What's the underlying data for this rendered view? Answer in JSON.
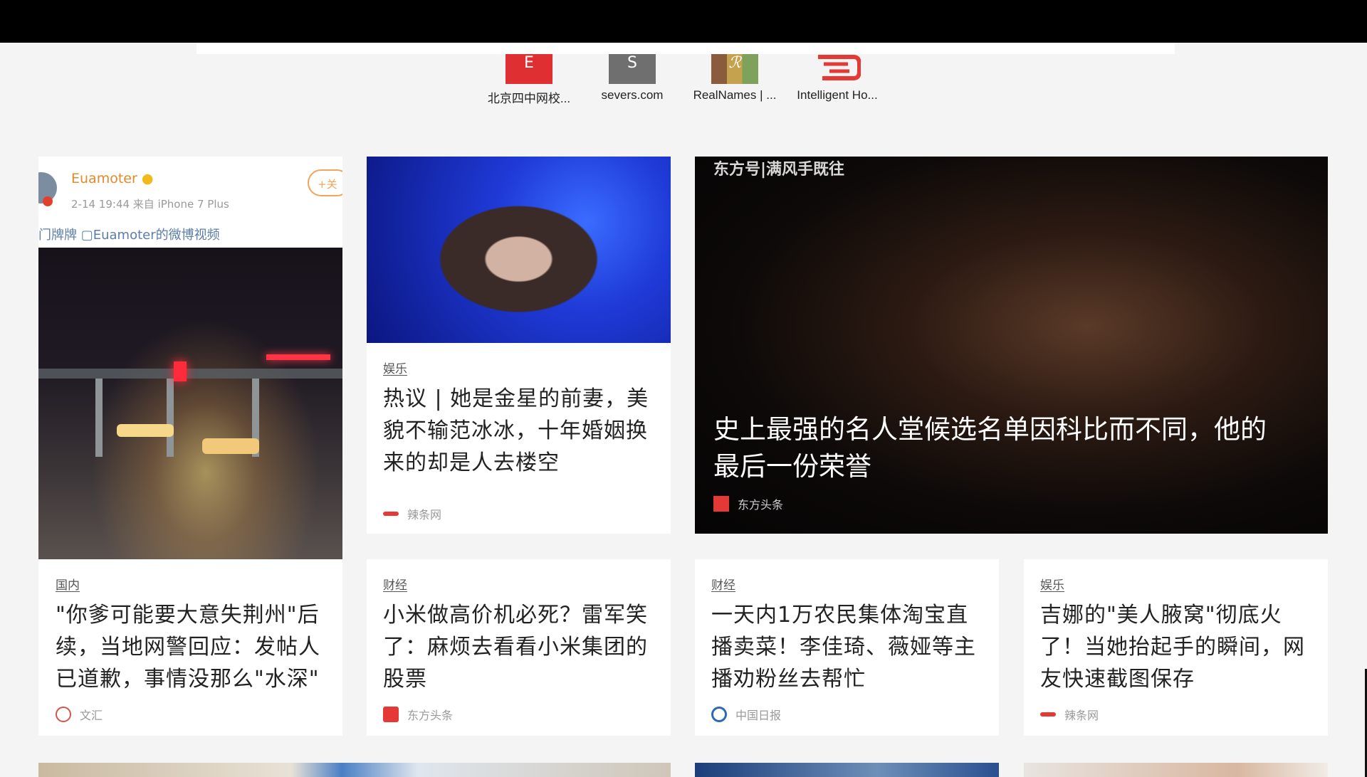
{
  "shortcuts": [
    {
      "letter": "E",
      "label": "北京四中网校...",
      "color": "#e02f33"
    },
    {
      "letter": "S",
      "label": "severs.com",
      "color": "#6f6f6f"
    },
    {
      "letter": "ℛ",
      "label": "RealNames | ...",
      "color": "#a07a4a"
    },
    {
      "letter": "",
      "label": "Intelligent Ho...",
      "color": "#e53935"
    }
  ],
  "feed": {
    "weibo_card": {
      "username": "Euamoter",
      "meta": "2-14 19:44  来自 iPhone 7 Plus",
      "follow_label": "+关",
      "tags_line": "门牌牌  ▢Euamoter的微博视频",
      "category": "国内",
      "title": "\"你爹可能要大意失荆州\"后续，当地网警回应：发帖人已道歉，事情没那么\"水深\"",
      "source": "文汇"
    },
    "card_entertainment_1": {
      "category": "娱乐",
      "title": "热议 | 她是金星的前妻，美貌不输范冰冰，十年婚姻换来的却是人去楼空",
      "source": "辣条网"
    },
    "feature_card": {
      "overlay_label": "东方号|满风手既往",
      "title": "史上最强的名人堂候选名单因科比而不同，他的最后一份荣誉",
      "source": "东方头条"
    },
    "card_finance_1": {
      "category": "财经",
      "title": "小米做高价机必死？雷军笑了：麻烦去看看小米集团的股票",
      "source": "东方头条"
    },
    "card_finance_2": {
      "category": "财经",
      "title": "一天内1万农民集体淘宝直播卖菜！李佳琦、薇娅等主播劝粉丝去帮忙",
      "source": "中国日报"
    },
    "card_entertainment_2": {
      "category": "娱乐",
      "title": "吉娜的\"美人腋窝\"彻底火了！当她抬起手的瞬间，网友快速截图保存",
      "source": "辣条网"
    }
  }
}
